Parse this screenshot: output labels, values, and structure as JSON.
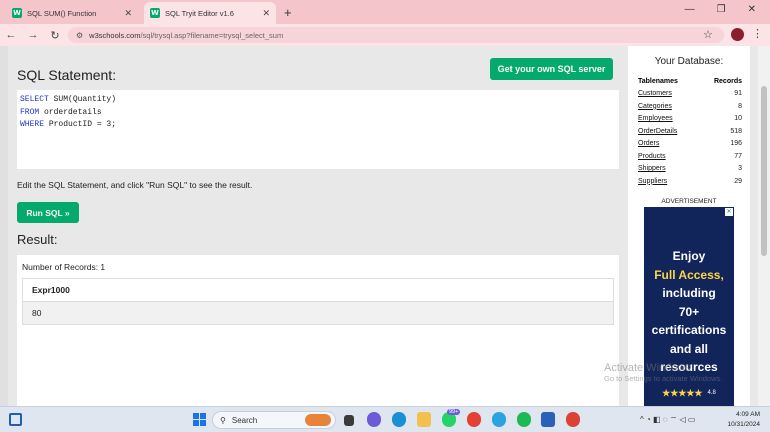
{
  "browser": {
    "tabs": [
      {
        "title": "SQL SUM() Function",
        "favicon": "W",
        "active": false
      },
      {
        "title": "SQL Tryit Editor v1.6",
        "favicon": "W",
        "active": true
      }
    ],
    "url_host": "w3schools.com",
    "url_path": "/sql/trysql.asp?filename=trysql_select_sum"
  },
  "main": {
    "heading": "SQL Statement:",
    "get_sql_label": "Get your own SQL server",
    "sql_lines": [
      {
        "keyword": "SELECT",
        "rest": " SUM(Quantity)"
      },
      {
        "keyword": "FROM",
        "rest": " orderdetails"
      },
      {
        "keyword": "WHERE",
        "rest": " ProductID = 3;"
      }
    ],
    "instructions": "Edit the SQL Statement, and click \"Run SQL\" to see the result.",
    "run_label": "Run SQL »",
    "result_heading": "Result:",
    "records_text": "Number of Records: 1",
    "result_column": "Expr1000",
    "result_value": "80"
  },
  "database": {
    "title": "Your Database:",
    "col_names": "Tablenames",
    "col_records": "Records",
    "tables": [
      {
        "name": "Customers",
        "count": "91"
      },
      {
        "name": "Categories",
        "count": "8"
      },
      {
        "name": "Employees",
        "count": "10"
      },
      {
        "name": "OrderDetails",
        "count": "518"
      },
      {
        "name": "Orders",
        "count": "196"
      },
      {
        "name": "Products",
        "count": "77"
      },
      {
        "name": "Shippers",
        "count": "3"
      },
      {
        "name": "Suppliers",
        "count": "29"
      }
    ]
  },
  "ad": {
    "label": "ADVERTISEMENT",
    "line1": "Enjoy",
    "line2": "Full Access,",
    "line3": "including",
    "line4": "70+",
    "line5": "certifications",
    "line6": "and all",
    "line7": "resources",
    "rating": "4.8",
    "close_glyph": "✕"
  },
  "watermark": {
    "line1": "Activate Windows",
    "line2": "Go to Settings to activate Windows."
  },
  "taskbar": {
    "search_placeholder": "Search",
    "time": "4:09 AM",
    "date": "10/31/2024",
    "badge": "99+"
  },
  "colors": {
    "accent_green": "#04aa6d",
    "tab_bar": "#f4c6cc",
    "sql_keyword": "#1e36c8"
  }
}
